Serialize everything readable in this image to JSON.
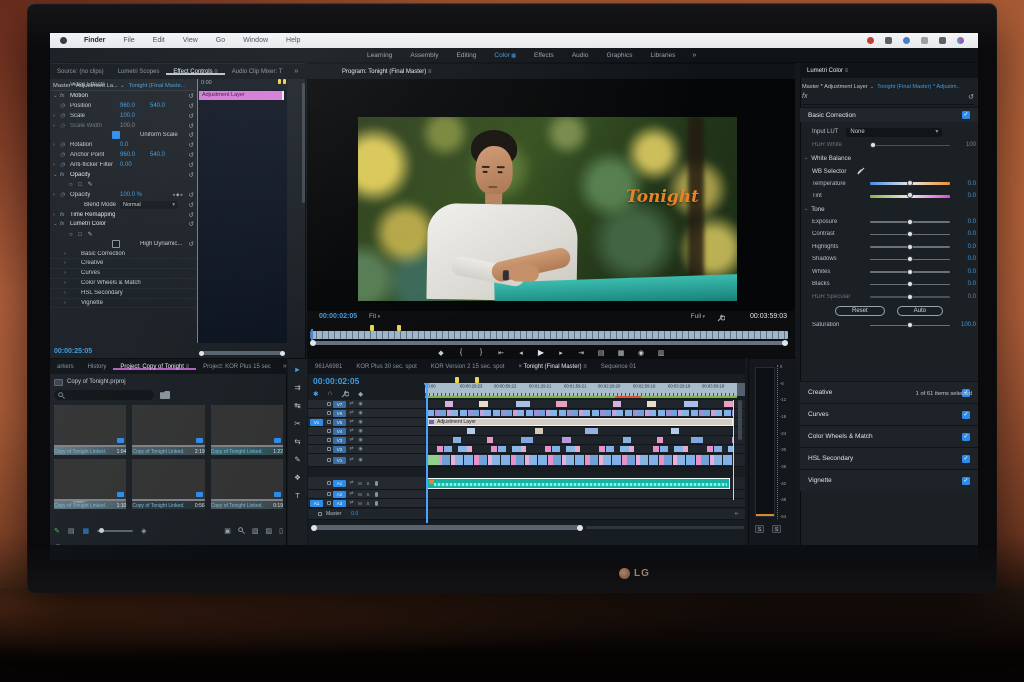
{
  "colors": {
    "accent": "#2d8ceb",
    "teal": "#22c3b0",
    "marker_yellow": "#e8d44d",
    "title_orange": "#e8832a"
  },
  "menu_bar": {
    "items": [
      {
        "label": "Finder",
        "cls": "appname"
      },
      {
        "label": "File"
      },
      {
        "label": "Edit"
      },
      {
        "label": "View"
      },
      {
        "label": "Go"
      },
      {
        "label": "Window"
      },
      {
        "label": "Help"
      }
    ]
  },
  "workspace": {
    "tabs": [
      {
        "label": "Learning"
      },
      {
        "label": "Assembly"
      },
      {
        "label": "Editing"
      },
      {
        "label": "Color",
        "active": true
      },
      {
        "label": "Effects"
      },
      {
        "label": "Audio"
      },
      {
        "label": "Graphics"
      },
      {
        "label": "Libraries"
      }
    ],
    "overflow": "»"
  },
  "left_panel": {
    "tabs": [
      {
        "label": "Source: (no clips)"
      },
      {
        "label": "Lumetri Scopes"
      },
      {
        "label": "Effect Controls",
        "active": true,
        "cls": "u-act"
      },
      {
        "label": "Audio Clip Mixer: T"
      }
    ],
    "overflow": "»",
    "effect_controls": {
      "master": "Master * Adjustment La...",
      "clip": "Tonight (Final Maste...",
      "mini_ruler": "0:00",
      "mini_clip": "Adjustment Layer",
      "footer_timecode": "00:00:25:05",
      "rows": [
        {
          "cls": "section",
          "label": "Video Effects"
        },
        {
          "cls": "effect",
          "tw": "⌄",
          "ic": "fx",
          "label": "Motion",
          "name": "effect-motion"
        },
        {
          "cls": "prop",
          "ic": "◷",
          "label": "Position",
          "v1": "960.0",
          "v2": "540.0"
        },
        {
          "cls": "prop",
          "tw": "›",
          "ic": "◷",
          "label": "Scale",
          "v1": "100.0"
        },
        {
          "cls": "prop disabled",
          "tw": "›",
          "ic": "◷",
          "label": "Scale Width",
          "v1": "100.0"
        },
        {
          "cls": "check checked",
          "label": "Uniform Scale"
        },
        {
          "cls": "prop",
          "tw": "›",
          "ic": "◷",
          "label": "Rotation",
          "v1": "0.0"
        },
        {
          "cls": "prop",
          "ic": "◷",
          "label": "Anchor Point",
          "v1": "960.0",
          "v2": "540.0"
        },
        {
          "cls": "prop",
          "tw": "›",
          "ic": "◷",
          "label": "Anti-flicker Filter",
          "v1": "0.00"
        },
        {
          "cls": "effect",
          "tw": "⌄",
          "ic": "fx",
          "label": "Opacity",
          "name": "effect-opacity"
        },
        {
          "cls": "shapes"
        },
        {
          "cls": "prop",
          "tw": "›",
          "ic": "◷",
          "label": "Opacity",
          "v1": "100.0 %",
          "kf": "◂ ◆ ▸"
        },
        {
          "cls": "selrow",
          "label": "Blend Mode",
          "v1": "Normal"
        },
        {
          "cls": "effect collapsed",
          "tw": "›",
          "ic": "fx",
          "label": "Time Remapping",
          "name": "effect-time-remapping"
        },
        {
          "cls": "effect",
          "tw": "⌄",
          "ic": "fx",
          "label": "Lumetri Color",
          "name": "effect-lumetri-color"
        },
        {
          "cls": "shapes"
        },
        {
          "cls": "check",
          "label": "High Dynamic..."
        },
        {
          "cls": "group",
          "tw": "›",
          "label": "Basic Correction"
        },
        {
          "cls": "group",
          "tw": "›",
          "label": "Creative"
        },
        {
          "cls": "group",
          "tw": "›",
          "label": "Curves"
        },
        {
          "cls": "group",
          "tw": "›",
          "label": "Color Wheels & Match"
        },
        {
          "cls": "group",
          "tw": "›",
          "label": "HSL Secondary"
        },
        {
          "cls": "group",
          "tw": "›",
          "label": "Vignette"
        }
      ]
    }
  },
  "program": {
    "tab": "Program: Tonight (Final Master)",
    "overlay": "Tonight",
    "timecode": "00:00:02:05",
    "fit": "Fit",
    "quality": "Full",
    "duration": "00:03:59:03",
    "add_button": "+",
    "transport": [
      {
        "name": "add-marker-icon",
        "glyph": "◆"
      },
      {
        "name": "mark-in-icon",
        "glyph": "{"
      },
      {
        "name": "mark-out-icon",
        "glyph": "}"
      },
      {
        "name": "go-to-in-icon",
        "glyph": "⇤"
      },
      {
        "name": "step-back-icon",
        "glyph": "◂"
      },
      {
        "name": "play-icon",
        "glyph": "▶",
        "cls": "play"
      },
      {
        "name": "step-forward-icon",
        "glyph": "▸"
      },
      {
        "name": "go-to-out-icon",
        "glyph": "⇥"
      },
      {
        "name": "lift-icon",
        "glyph": "▤"
      },
      {
        "name": "extract-icon",
        "glyph": "▦"
      },
      {
        "name": "export-frame-icon",
        "glyph": "◉"
      },
      {
        "name": "comparison-view-icon",
        "glyph": "▥"
      }
    ]
  },
  "lumetri": {
    "tab": "Lumetri Color",
    "master": "Master * Adjustment Layer",
    "clip": "Tonight (Final Master) * Adjustm..",
    "fx_label": "fx",
    "basic_title": "Basic Correction",
    "input_lut_label": "Input LUT",
    "input_lut_value": "None",
    "hdr_white": {
      "label": "HDR White",
      "value": "100",
      "cls": "disabled hdrw"
    },
    "wb_title": "White Balance",
    "wb_selector_label": "WB Selector",
    "wb_sliders": [
      {
        "label": "Temperature",
        "value": "0.0",
        "cls": "temp"
      },
      {
        "label": "Tint",
        "value": "0.0",
        "cls": "tint"
      }
    ],
    "tone_title": "Tone",
    "tone_sliders": [
      {
        "label": "Exposure",
        "value": "0.0"
      },
      {
        "label": "Contrast",
        "value": "0.0"
      },
      {
        "label": "Highlights",
        "value": "0.0"
      },
      {
        "label": "Shadows",
        "value": "0.0"
      },
      {
        "label": "Whites",
        "value": "0.0"
      },
      {
        "label": "Blacks",
        "value": "0.0"
      },
      {
        "label": "HDR Specular",
        "value": "0.0",
        "cls": "disabled"
      }
    ],
    "reset_label": "Reset",
    "auto_label": "Auto",
    "saturation": {
      "label": "Saturation",
      "value": "100.0"
    },
    "sections": [
      {
        "label": "Creative"
      },
      {
        "label": "Curves"
      },
      {
        "label": "Color Wheels & Match"
      },
      {
        "label": "HSL Secondary"
      },
      {
        "label": "Vignette"
      }
    ]
  },
  "project": {
    "tabs": [
      {
        "label": "arkers"
      },
      {
        "label": "History"
      },
      {
        "label": "Project: Copy of Tonight",
        "active": true,
        "cls": "u-pink"
      },
      {
        "label": "Project: KOR Plus 15 sec"
      }
    ],
    "overflow": "»",
    "file": "Copy of Tonight.prproj",
    "status": "1 of 61 items selected",
    "clips": [
      {
        "title": "Copy of Tonight Linked...",
        "dur": "1:04",
        "cls": "t1"
      },
      {
        "title": "Copy of Tonight Linked...",
        "dur": "2:19",
        "cls": "t2"
      },
      {
        "title": "Copy of Tonight Linked...",
        "dur": "1:22",
        "cls": "t3"
      },
      {
        "title": "Copy of Tonight Linked...",
        "dur": "1:10",
        "cls": "t4"
      },
      {
        "title": "Copy of Tonight Linked...",
        "dur": "0:56",
        "cls": "t5"
      },
      {
        "title": "Copy of Tonight Linked...",
        "dur": "0:19",
        "cls": "t6"
      }
    ]
  },
  "tools": [
    {
      "name": "selection-tool",
      "glyph": "►",
      "cls": "active"
    },
    {
      "name": "track-select-tool",
      "glyph": "⇉"
    },
    {
      "name": "ripple-edit-tool",
      "glyph": "↹"
    },
    {
      "name": "razor-tool",
      "glyph": "✂"
    },
    {
      "name": "slip-tool",
      "glyph": "⇆"
    },
    {
      "name": "pen-tool",
      "glyph": "✎"
    },
    {
      "name": "hand-tool",
      "glyph": "❖"
    },
    {
      "name": "type-tool",
      "glyph": "T"
    }
  ],
  "timeline": {
    "tabs": [
      {
        "label": "961A6981"
      },
      {
        "label": "KOR Plus 30 sec. spot"
      },
      {
        "label": "KOR Version 2 15 sec. spot"
      },
      {
        "label": "Tonight (Final Master)",
        "active": true,
        "cls": "closex"
      },
      {
        "label": "Sequence 01"
      }
    ],
    "timecode": "00:00:02:05",
    "ruler": [
      "00:00",
      "00:00:29:23",
      "00:00:59:22",
      "00:01:29:21",
      "00:01:59:21",
      "00:02:29:20",
      "00:02:59:19",
      "00:03:29:18",
      "00:03:59:18"
    ],
    "video_tracks": [
      {
        "name": "V7",
        "cls": "p-v7"
      },
      {
        "name": "V6",
        "cls": "p-v6"
      },
      {
        "name": "V5",
        "cls": "p-v5",
        "patch": "V1"
      },
      {
        "name": "V4",
        "cls": "p-v4"
      },
      {
        "name": "V3",
        "cls": "p-v3"
      },
      {
        "name": "V2",
        "cls": "p-v2"
      },
      {
        "name": "V1",
        "cls": "p-v1 tall"
      }
    ],
    "audio_tracks": [
      {
        "name": "A1",
        "cls": "tall"
      },
      {
        "name": "A2"
      },
      {
        "name": "A3",
        "patch": "A1"
      }
    ],
    "master_label": "Master",
    "master_value": "0.0",
    "adjustment_clip": "Adjustment Layer"
  },
  "meter": {
    "ticks": [
      "0",
      "-6",
      "-12",
      "-18",
      "-24",
      "-30",
      "-36",
      "-42",
      "-48",
      "-54"
    ],
    "solo": "S",
    "solo2": "S"
  },
  "monitor": {
    "brand": "LG"
  }
}
